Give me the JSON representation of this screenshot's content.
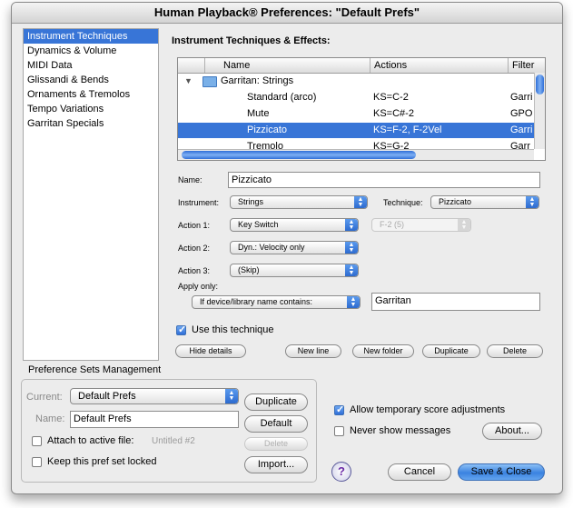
{
  "window": {
    "title": "Human Playback® Preferences: \"Default Prefs\""
  },
  "sidebar": {
    "items": [
      {
        "label": "Instrument Techniques",
        "selected": true
      },
      {
        "label": "Dynamics & Volume"
      },
      {
        "label": "MIDI Data"
      },
      {
        "label": "Glissandi & Bends"
      },
      {
        "label": "Ornaments & Tremolos"
      },
      {
        "label": "Tempo Variations"
      },
      {
        "label": "Garritan Specials"
      }
    ]
  },
  "main": {
    "title": "Instrument Techniques & Effects:",
    "table": {
      "columns": [
        "Name",
        "Actions",
        "Filter"
      ],
      "group_row": {
        "name": "Garritan: Strings"
      },
      "rows": [
        {
          "name": "Standard (arco)",
          "actions": "KS=C-2",
          "filter": "Garri"
        },
        {
          "name": "Mute",
          "actions": "KS=C#-2",
          "filter": "GPO"
        },
        {
          "name": "Pizzicato",
          "actions": "KS=F-2, F-2Vel",
          "filter": "Garri",
          "selected": true
        },
        {
          "name": "Tremolo",
          "actions": "KS=G-2",
          "filter": "Garr"
        }
      ]
    },
    "name_label": "Name:",
    "name_value": "Pizzicato",
    "instrument_label": "Instrument:",
    "instrument_value": "Strings",
    "technique_label": "Technique:",
    "technique_value": "Pizzicato",
    "action1_label": "Action 1:",
    "action1_value": "Key Switch",
    "action1_param": "F-2 (5)",
    "action2_label": "Action 2:",
    "action2_value": "Dyn.: Velocity only",
    "action3_label": "Action 3:",
    "action3_value": "(Skip)",
    "apply_only_label": "Apply only:",
    "apply_condition": "If device/library name contains:",
    "apply_text": "Garritan",
    "use_technique_label": "Use this technique",
    "use_technique_checked": true,
    "buttons": {
      "hide_details": "Hide details",
      "new_line": "New line",
      "new_folder": "New folder",
      "duplicate": "Duplicate",
      "delete": "Delete"
    }
  },
  "pref_sets": {
    "title": "Preference Sets Management",
    "current_label": "Current:",
    "current_value": "Default Prefs",
    "name_label": "Name:",
    "name_value": "Default Prefs",
    "duplicate_button": "Duplicate",
    "default_button": "Default",
    "attach_label": "Attach to active file:",
    "attach_file": "Untitled #2",
    "attach_checked": false,
    "delete_button": "Delete",
    "lock_label": "Keep this pref set locked",
    "lock_checked": false,
    "import_button": "Import..."
  },
  "options": {
    "allow_temp_label": "Allow temporary score adjustments",
    "allow_temp_checked": true,
    "never_show_label": "Never show messages",
    "never_show_checked": false,
    "about_button": "About..."
  },
  "footer": {
    "help_glyph": "?",
    "cancel_button": "Cancel",
    "save_button": "Save & Close"
  },
  "colors": {
    "selection": "#3875d7",
    "window_bg": "#ececec",
    "primary_button": "#3a82e0"
  }
}
